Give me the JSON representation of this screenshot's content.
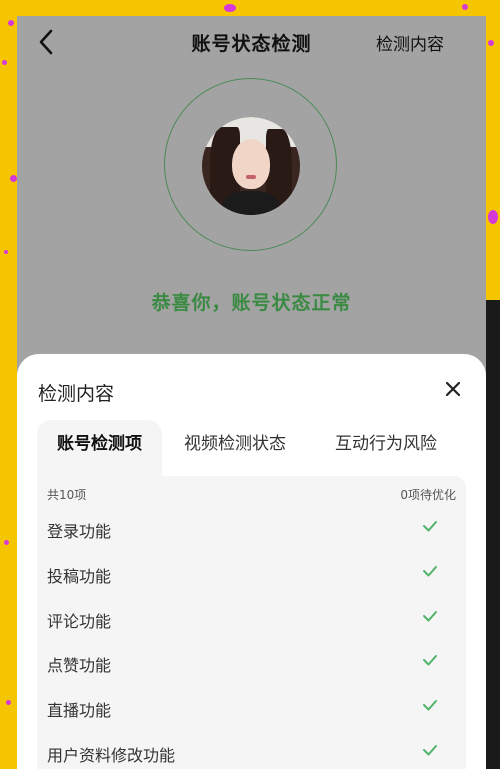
{
  "header": {
    "title": "账号状态检测",
    "right_action": "检测内容"
  },
  "status": {
    "message": "恭喜你，账号状态正常",
    "color": "#3a8a43"
  },
  "sheet": {
    "title": "检测内容",
    "tabs": [
      {
        "label": "账号检测项",
        "active": true
      },
      {
        "label": "视频检测状态",
        "active": false
      },
      {
        "label": "互动行为风险",
        "active": false
      }
    ],
    "summary_left": "共10项",
    "summary_right": "0项待优化",
    "items": [
      {
        "label": "登录功能",
        "icon": "check-icon"
      },
      {
        "label": "投稿功能",
        "icon": "check-icon"
      },
      {
        "label": "评论功能",
        "icon": "check-icon"
      },
      {
        "label": "点赞功能",
        "icon": "check-icon"
      },
      {
        "label": "直播功能",
        "icon": "check-icon"
      },
      {
        "label": "用户资料修改功能",
        "icon": "check-icon"
      }
    ]
  },
  "colors": {
    "accent_green": "#3a8a43",
    "check_green": "#4fb36a",
    "frame_yellow": "#f5c500"
  }
}
